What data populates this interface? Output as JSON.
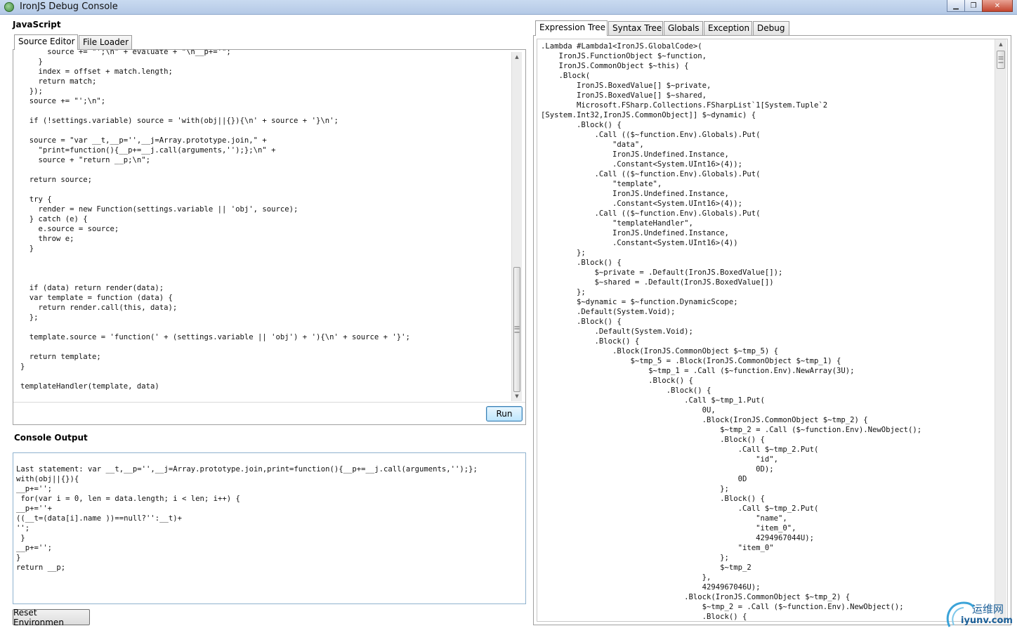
{
  "window": {
    "title": "IronJS Debug Console",
    "minimize_glyph": "▁",
    "maximize_glyph": "❐",
    "close_glyph": "✕"
  },
  "javascript": {
    "heading": "JavaScript",
    "tabs": [
      "Source Editor",
      "File Loader"
    ],
    "active_tab": "Source Editor",
    "source_code": "      source += \"';\\n\" + evaluate + \"\\n__p+='\";\n    }\n    index = offset + match.length;\n    return match;\n  });\n  source += \"';\\n\";\n\n  if (!settings.variable) source = 'with(obj||{}){\\n' + source + '}\\n';\n\n  source = \"var __t,__p='',__j=Array.prototype.join,\" +\n    \"print=function(){__p+=__j.call(arguments,'');};\\n\" +\n    source + \"return __p;\\n\";\n\n  return source;\n\n  try {\n    render = new Function(settings.variable || 'obj', source);\n  } catch (e) {\n    e.source = source;\n    throw e;\n  }\n\n\n\n  if (data) return render(data);\n  var template = function (data) {\n    return render.call(this, data);\n  };\n\n  template.source = 'function(' + (settings.variable || 'obj') + '){\\n' + source + '}';\n\n  return template;\n}\n\ntemplateHandler(template, data)",
    "run_label": "Run"
  },
  "console": {
    "heading": "Console Output",
    "output": "Last statement: var __t,__p='',__j=Array.prototype.join,print=function(){__p+=__j.call(arguments,'');};\nwith(obj||{}){\n__p+='';\n for(var i = 0, len = data.length; i < len; i++) {\n__p+=''+\n((__t=(data[i].name ))==null?'':__t)+\n'';\n }\n__p+='';\n}\nreturn __p;",
    "reset_label": "Reset Environmen"
  },
  "inspector": {
    "tabs": [
      "Expression Tree",
      "Syntax Tree",
      "Globals",
      "Exception",
      "Debug"
    ],
    "active_tab": "Expression Tree",
    "expression_tree": ".Lambda #Lambda1<IronJS.GlobalCode>(\n    IronJS.FunctionObject $~function,\n    IronJS.CommonObject $~this) {\n    .Block(\n        IronJS.BoxedValue[] $~private,\n        IronJS.BoxedValue[] $~shared,\n        Microsoft.FSharp.Collections.FSharpList`1[System.Tuple`2\n[System.Int32,IronJS.CommonObject]] $~dynamic) {\n        .Block() {\n            .Call (($~function.Env).Globals).Put(\n                \"data\",\n                IronJS.Undefined.Instance,\n                .Constant<System.UInt16>(4));\n            .Call (($~function.Env).Globals).Put(\n                \"template\",\n                IronJS.Undefined.Instance,\n                .Constant<System.UInt16>(4));\n            .Call (($~function.Env).Globals).Put(\n                \"templateHandler\",\n                IronJS.Undefined.Instance,\n                .Constant<System.UInt16>(4))\n        };\n        .Block() {\n            $~private = .Default(IronJS.BoxedValue[]);\n            $~shared = .Default(IronJS.BoxedValue[])\n        };\n        $~dynamic = $~function.DynamicScope;\n        .Default(System.Void);\n        .Block() {\n            .Default(System.Void);\n            .Block() {\n                .Block(IronJS.CommonObject $~tmp_5) {\n                    $~tmp_5 = .Block(IronJS.CommonObject $~tmp_1) {\n                        $~tmp_1 = .Call ($~function.Env).NewArray(3U);\n                        .Block() {\n                            .Block() {\n                                .Call $~tmp_1.Put(\n                                    0U,\n                                    .Block(IronJS.CommonObject $~tmp_2) {\n                                        $~tmp_2 = .Call ($~function.Env).NewObject();\n                                        .Block() {\n                                            .Call $~tmp_2.Put(\n                                                \"id\",\n                                                0D);\n                                            0D\n                                        };\n                                        .Block() {\n                                            .Call $~tmp_2.Put(\n                                                \"name\",\n                                                \"item_0\",\n                                                4294967044U);\n                                            \"item_0\"\n                                        };\n                                        $~tmp_2\n                                    },\n                                    4294967046U);\n                                .Block(IronJS.CommonObject $~tmp_2) {\n                                    $~tmp_2 = .Call ($~function.Env).NewObject();\n                                    .Block() {"
  },
  "watermark": {
    "cn": "运维网",
    "site": "iyunv.com"
  }
}
